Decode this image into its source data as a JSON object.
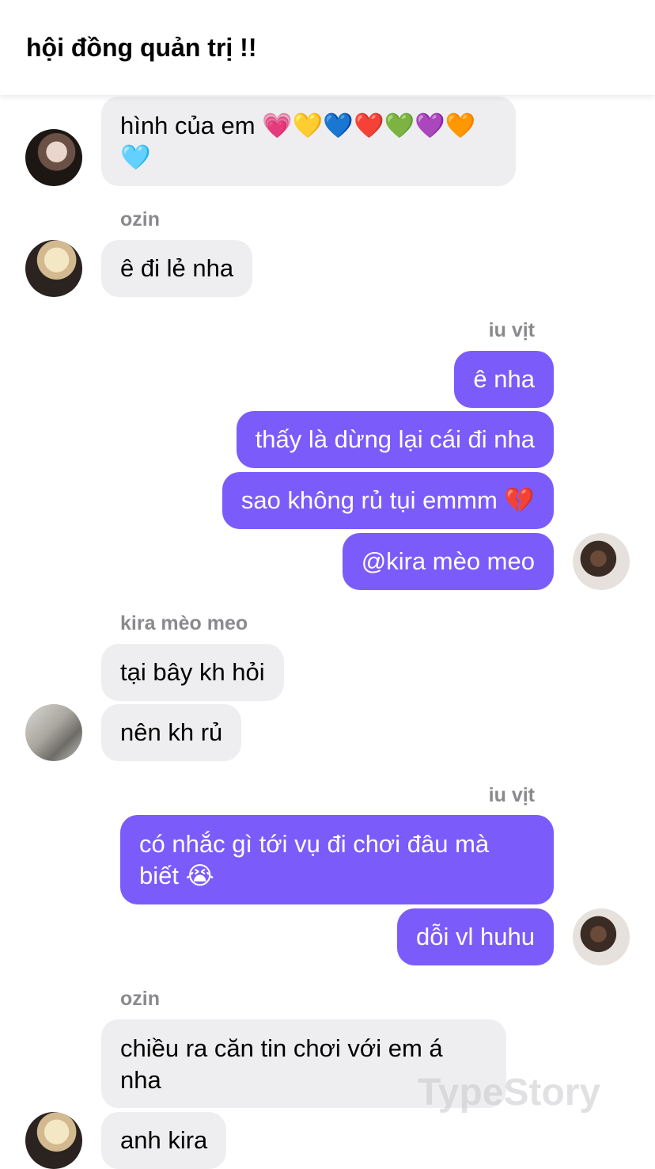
{
  "header": {
    "title": "hội đồng quản trị !!"
  },
  "colors": {
    "incoming_bubble": "#eeeef0",
    "outgoing_bubble": "#7b5cfa",
    "sender_name": "#8a8a8e"
  },
  "messages": [
    {
      "side": "incoming",
      "text": "hình của em 💗💛💙❤️💚💜🧡🩵"
    },
    {
      "side": "incoming",
      "sender": "ozin",
      "text": "ê đi lẻ nha"
    },
    {
      "side": "outgoing",
      "sender": "iu vịt",
      "text": "ê nha"
    },
    {
      "side": "outgoing",
      "text": "thấy là dừng lại cái đi nha"
    },
    {
      "side": "outgoing",
      "text": "sao không rủ tụi emmm 💔"
    },
    {
      "side": "outgoing",
      "text": "@kira mèo meo"
    },
    {
      "side": "incoming",
      "sender": "kira mèo meo",
      "text": "tại bây kh hỏi"
    },
    {
      "side": "incoming",
      "text": "nên kh rủ"
    },
    {
      "side": "outgoing",
      "sender": "iu vịt",
      "text": "có nhắc gì tới vụ đi chơi đâu mà biết 😭"
    },
    {
      "side": "outgoing",
      "text": "dỗi vl huhu"
    },
    {
      "side": "incoming",
      "sender": "ozin",
      "text": "chiều ra căn tin chơi với em á nha"
    },
    {
      "side": "incoming",
      "text": "anh kira"
    }
  ],
  "avatars": [
    "user-avatar",
    "ozin-avatar",
    "iu-vit-avatar",
    "kira-meo-meo-avatar",
    "iu-vit-avatar",
    "ozin-avatar"
  ],
  "watermark": "TypeStory"
}
